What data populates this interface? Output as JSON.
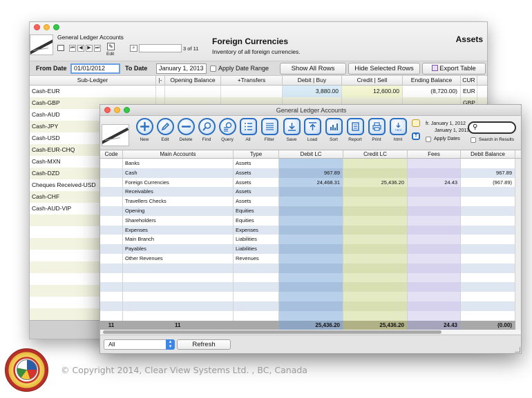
{
  "back_window": {
    "window_title": "General Ledger Accounts",
    "record_counter": "3 of 11",
    "edit_label": "Edit",
    "page_title": "Foreign Currencies",
    "page_subtitle": "Inventory of all foreign currencies.",
    "category": "Assets",
    "filters": {
      "from_date_label": "From Date",
      "from_date_value": "01/01/2012",
      "to_date_label": "To Date",
      "to_date_value": "January 1, 2013",
      "apply_range_label": "Apply Date Range",
      "show_all_label": "Show All Rows",
      "hide_selected_label": "Hide Selected Rows",
      "export_label": "Export Table"
    },
    "columns": [
      "Sub-Ledger",
      "|-",
      "Opening Balance",
      "+Transfers",
      "Debit | Buy",
      "Credit | Sell",
      "Ending Balance",
      "CUR"
    ],
    "rows": [
      {
        "name": "Cash-EUR",
        "debit": "3,880.00",
        "credit": "12,600.00",
        "ending": "(8,720.00)",
        "cur": "EUR"
      },
      {
        "name": "Cash-GBP",
        "debit": "",
        "credit": "",
        "ending": "",
        "cur": "GBP"
      },
      {
        "name": "Cash-AUD",
        "debit": "",
        "credit": "",
        "ending": "",
        "cur": ""
      },
      {
        "name": "Cash-JPY",
        "debit": "",
        "credit": "",
        "ending": "",
        "cur": ""
      },
      {
        "name": "Cash-USD",
        "debit": "",
        "credit": "",
        "ending": "",
        "cur": ""
      },
      {
        "name": "Cash-EUR-CHQ",
        "debit": "",
        "credit": "",
        "ending": "",
        "cur": ""
      },
      {
        "name": "Cash-MXN",
        "debit": "",
        "credit": "",
        "ending": "",
        "cur": ""
      },
      {
        "name": "Cash-DZD",
        "debit": "",
        "credit": "",
        "ending": "",
        "cur": ""
      },
      {
        "name": "Cheques Received-USD",
        "debit": "",
        "credit": "",
        "ending": "",
        "cur": ""
      },
      {
        "name": "Cash-CHF",
        "debit": "",
        "credit": "",
        "ending": "",
        "cur": ""
      },
      {
        "name": "Cash-AUD-VIP",
        "debit": "",
        "credit": "",
        "ending": "",
        "cur": ""
      }
    ]
  },
  "front_window": {
    "window_title": "General Ledger Accounts",
    "toolbar": [
      {
        "label": "New",
        "icon": "plus-icon"
      },
      {
        "label": "Edit",
        "icon": "pencil-icon"
      },
      {
        "label": "Delete",
        "icon": "minus-icon"
      },
      {
        "label": "Find",
        "icon": "magnifier-icon"
      },
      {
        "label": "Query",
        "icon": "query-icon"
      },
      {
        "label": "All",
        "icon": "list-all-icon"
      },
      {
        "label": "Filter",
        "icon": "filter-list-icon"
      },
      {
        "label": "Save",
        "icon": "save-icon"
      },
      {
        "label": "Load",
        "icon": "load-icon"
      },
      {
        "label": "Sort",
        "icon": "sort-icon"
      },
      {
        "label": "Report",
        "icon": "report-icon"
      },
      {
        "label": "Print",
        "icon": "print-icon"
      },
      {
        "label": "html",
        "icon": "html-icon"
      }
    ],
    "date_from": "fr.  January 1, 2012",
    "date_to": "January 1, 2013",
    "apply_dates_label": "Apply Dates",
    "search_results_label": "Search in Results",
    "columns": [
      "Code",
      "Main Accounts",
      "Type",
      "Debit LC",
      "Credit LC",
      "Fees",
      "Debit Balance"
    ],
    "rows": [
      {
        "account": "Banks",
        "type": "Assets",
        "debit": "",
        "credit": "",
        "fees": "",
        "balance": ""
      },
      {
        "account": "Cash",
        "type": "Assets",
        "debit": "967.89",
        "credit": "",
        "fees": "",
        "balance": "967.89"
      },
      {
        "account": "Foreign Currencies",
        "type": "Assets",
        "debit": "24,468.31",
        "credit": "25,436.20",
        "fees": "24.43",
        "balance": "(967.89)"
      },
      {
        "account": "Receivables",
        "type": "Assets",
        "debit": "",
        "credit": "",
        "fees": "",
        "balance": ""
      },
      {
        "account": "Travellers Checks",
        "type": "Assets",
        "debit": "",
        "credit": "",
        "fees": "",
        "balance": ""
      },
      {
        "account": "Opening",
        "type": "Equities",
        "debit": "",
        "credit": "",
        "fees": "",
        "balance": ""
      },
      {
        "account": "Shareholders",
        "type": "Equities",
        "debit": "",
        "credit": "",
        "fees": "",
        "balance": ""
      },
      {
        "account": "Expenses",
        "type": "Expenses",
        "debit": "",
        "credit": "",
        "fees": "",
        "balance": ""
      },
      {
        "account": "Main Branch",
        "type": "Liabilities",
        "debit": "",
        "credit": "",
        "fees": "",
        "balance": ""
      },
      {
        "account": "Payables",
        "type": "Liabilities",
        "debit": "",
        "credit": "",
        "fees": "",
        "balance": ""
      },
      {
        "account": "Other Revenues",
        "type": "Revenues",
        "debit": "",
        "credit": "",
        "fees": "",
        "balance": ""
      }
    ],
    "totals": {
      "code": "11",
      "accounts": "11",
      "debit": "25,436.20",
      "credit": "25,436.20",
      "fees": "24.43",
      "balance": "(0.00)"
    },
    "popup_value": "All",
    "refresh_label": "Refresh"
  },
  "copyright": "© Copyright 2014, Clear View Systems Ltd. , BC, Canada"
}
